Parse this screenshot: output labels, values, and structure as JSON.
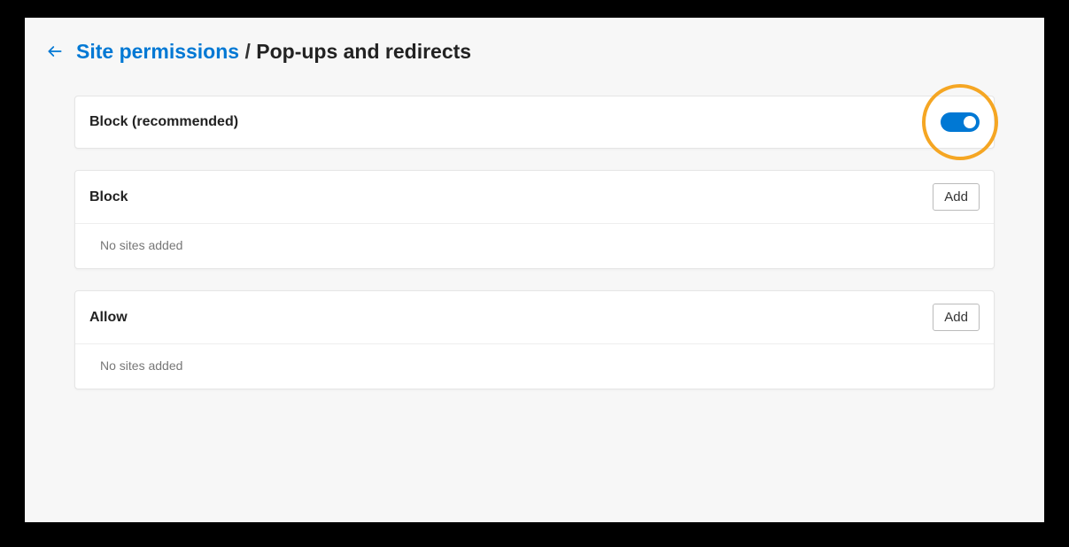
{
  "breadcrumb": {
    "parent": "Site permissions",
    "separator": " / ",
    "current": "Pop-ups and redirects"
  },
  "toggle_section": {
    "label": "Block (recommended)",
    "state": "on"
  },
  "block_section": {
    "title": "Block",
    "add_label": "Add",
    "empty_text": "No sites added"
  },
  "allow_section": {
    "title": "Allow",
    "add_label": "Add",
    "empty_text": "No sites added"
  }
}
